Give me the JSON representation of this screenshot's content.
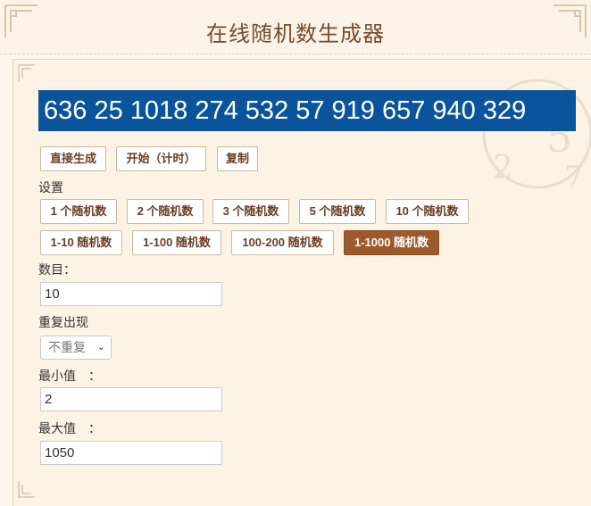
{
  "header": {
    "title": "在线随机数生成器"
  },
  "result": {
    "numbers": "636 25 1018 274 532 57 919 657 940 329"
  },
  "actions": {
    "generate": "直接生成",
    "start": "开始（计时）",
    "copy": "复制"
  },
  "settings": {
    "label": "设置",
    "count_presets": [
      "1 个随机数",
      "2 个随机数",
      "3 个随机数",
      "5 个随机数",
      "10 个随机数"
    ],
    "range_presets": [
      "1-10 随机数",
      "1-100 随机数",
      "100-200 随机数",
      "1-1000 随机数"
    ],
    "active_range": "1-1000 随机数"
  },
  "form": {
    "count_label": "数目：",
    "count_value": "10",
    "repeat_label": "重复出现",
    "repeat_value": "不重复",
    "min_label": "最小值　：",
    "min_value": "2",
    "max_label": "最大值　：",
    "max_value": "1050"
  },
  "colors": {
    "result_bg": "#0a549b",
    "active_button": "#9c5a2c",
    "title": "#7a4a2a"
  }
}
